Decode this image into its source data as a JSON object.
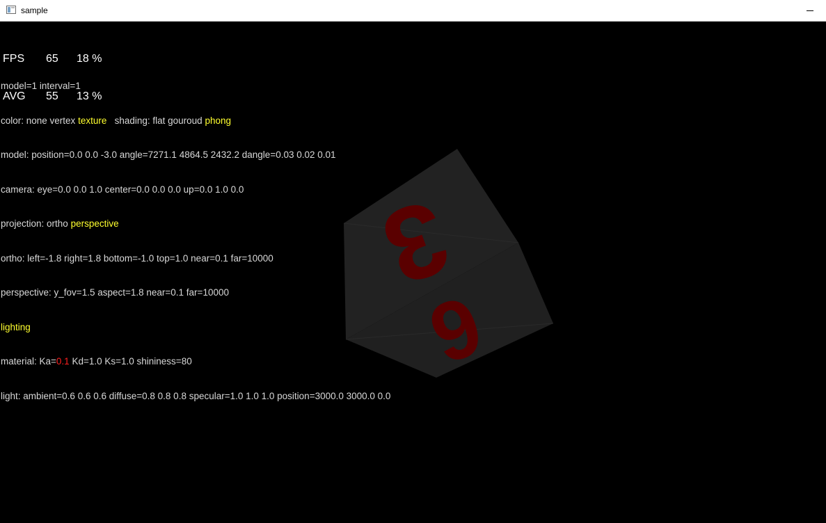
{
  "window": {
    "title": "sample",
    "app_icon": "window-app-icon",
    "minimize_icon": "minimize-icon"
  },
  "hud": {
    "fps": {
      "label": "FPS",
      "value": "65",
      "percent": "18 %"
    },
    "avg": {
      "label": "AVG",
      "value": "55",
      "percent": "13 %"
    }
  },
  "info": {
    "line1": "model=1 interval=1",
    "color_prefix": "color: none vertex ",
    "color_selected": "texture",
    "shading_prefix": "   shading: flat gouroud ",
    "shading_selected": "phong",
    "model_line": "model: position=0.0 0.0 -3.0 angle=7271.1 4864.5 2432.2 dangle=0.03 0.02 0.01",
    "camera_line": "camera: eye=0.0 0.0 1.0 center=0.0 0.0 0.0 up=0.0 1.0 0.0",
    "projection_prefix": "projection: ortho ",
    "projection_selected": "perspective",
    "ortho_line": "ortho: left=-1.8 right=1.8 bottom=-1.0 top=1.0 near=0.1 far=10000",
    "perspective_line": "perspective: y_fov=1.5 aspect=1.8 near=0.1 far=10000",
    "lighting": "lighting",
    "material_prefix": "material: Ka=",
    "material_ka": "0.1",
    "material_rest": " Kd=1.0 Ks=1.0 shininess=80",
    "light_line": "light: ambient=0.6 0.6 0.6 diffuse=0.8 0.8 0.8 specular=1.0 1.0 1.0 position=3000.0 3000.0 0.0"
  },
  "scene": {
    "face_top_number": "3",
    "face_bottom_number": "6",
    "colors": {
      "face": "#1f1f1f",
      "number": "#5a0000",
      "highlight": "#ffff2e",
      "alert": "#ff2020"
    }
  }
}
